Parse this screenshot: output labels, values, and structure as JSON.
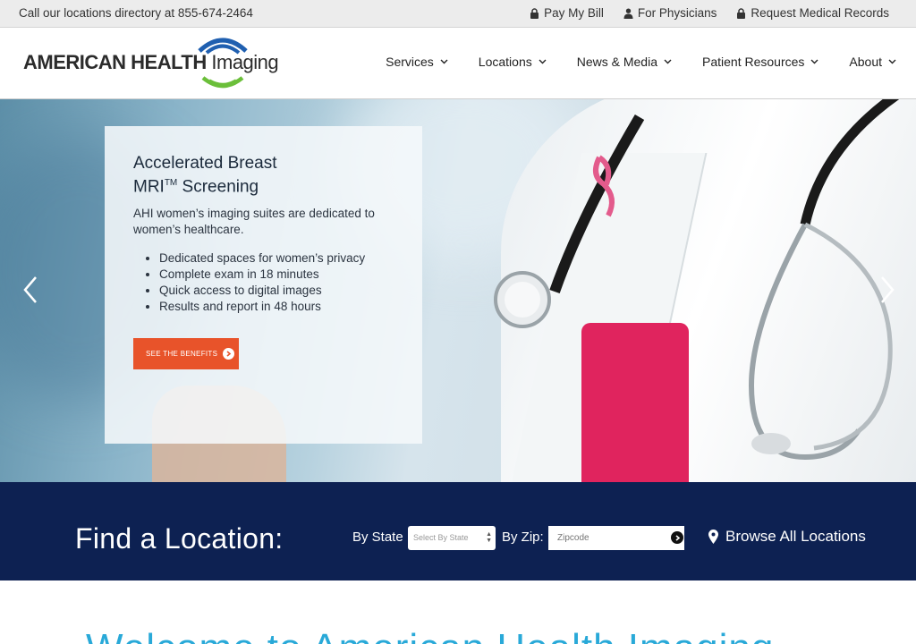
{
  "topbar": {
    "phone_text": "Call our locations directory at 855-674-2464",
    "links": [
      {
        "label": "Pay My Bill",
        "icon": "lock-icon"
      },
      {
        "label": "For Physicians",
        "icon": "user-icon"
      },
      {
        "label": "Request Medical Records",
        "icon": "lock-icon"
      }
    ]
  },
  "header": {
    "logo_bold": "AMERICAN HEALTH",
    "logo_light": "Imaging",
    "nav": [
      {
        "label": "Services"
      },
      {
        "label": "Locations"
      },
      {
        "label": "News & Media"
      },
      {
        "label": "Patient Resources"
      },
      {
        "label": "About"
      }
    ]
  },
  "hero": {
    "title_line1": "Accelerated Breast",
    "title_line2": "MRI",
    "title_tm": "TM",
    "title_line2_rest": " Screening",
    "description": "AHI women’s imaging suites are dedicated to women’s healthcare.",
    "bullets": [
      "Dedicated spaces for women’s privacy",
      "Complete exam in 18 minutes",
      "Quick access to digital images",
      "Results and report in 48 hours"
    ],
    "cta_label": "SEE THE BENEFITS"
  },
  "finder": {
    "title": "Find a Location:",
    "by_state_label": "By State",
    "state_placeholder": "Select By State",
    "by_zip_label": "By Zip:",
    "zip_placeholder": "Zipcode",
    "browse_label": "Browse All Locations"
  },
  "welcome": {
    "heading": "Welcome to American Health Imaging"
  },
  "colors": {
    "navy": "#0d2152",
    "cta_orange": "#e8532a",
    "accent_blue": "#29a9d8",
    "logo_blue": "#1f5fb0",
    "logo_green": "#6bbf3a"
  }
}
